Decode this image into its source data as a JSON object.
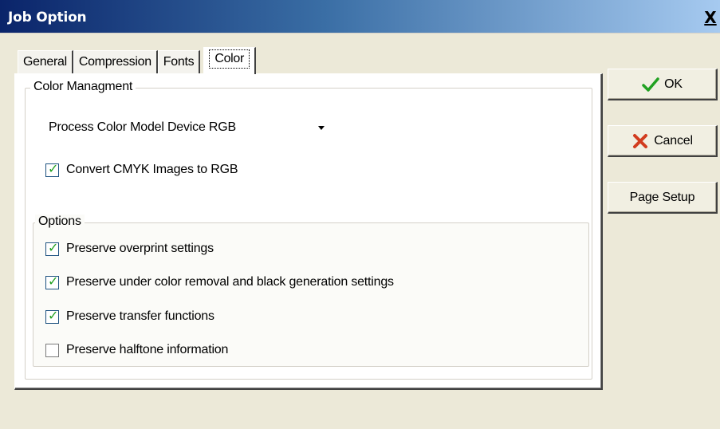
{
  "window": {
    "title": "Job Option",
    "close_label": "X"
  },
  "tabs": [
    {
      "label": "General"
    },
    {
      "label": "Compression"
    },
    {
      "label": "Fonts"
    },
    {
      "label": "Color",
      "active": true
    }
  ],
  "color_group": {
    "legend": "Color Managment",
    "model_select": {
      "value": "Process Color Model Device RGB"
    },
    "convert_cmyk": {
      "label": "Convert CMYK Images to RGB",
      "checked": true
    }
  },
  "options_group": {
    "legend": "Options",
    "items": [
      {
        "label": "Preserve overprint settings",
        "checked": true
      },
      {
        "label": "Preserve under color removal and black generation settings",
        "checked": true
      },
      {
        "label": "Preserve transfer functions",
        "checked": true
      },
      {
        "label": "Preserve halftone information",
        "checked": false
      }
    ]
  },
  "buttons": {
    "ok_label": "OK",
    "cancel_label": "Cancel",
    "page_setup_label": "Page Setup"
  },
  "colors": {
    "title_gradient_start": "#0a246a",
    "title_gradient_end": "#a6caf0",
    "dialog_bg": "#ece9d8",
    "check_mark": "#21a121",
    "cancel_x": "#d23c1f"
  }
}
